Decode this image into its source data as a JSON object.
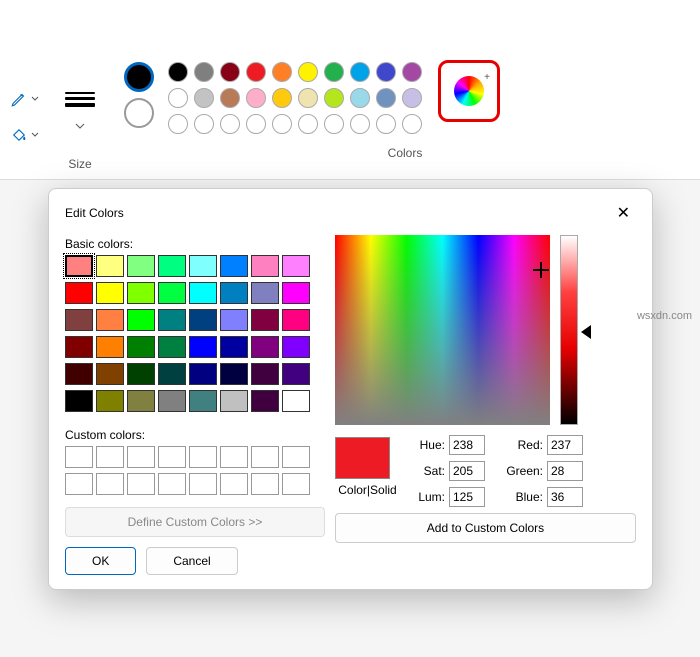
{
  "ribbon": {
    "size_label": "Size",
    "colors_label": "Colors",
    "palette": [
      "#000000",
      "#7f7f7f",
      "#880015",
      "#ed1c24",
      "#ff7f27",
      "#fff200",
      "#22b14c",
      "#00a2e8",
      "#3f48cc",
      "#a349a4",
      "#ffffff",
      "#c3c3c3",
      "#b97a57",
      "#ffaec9",
      "#ffc90e",
      "#efe4b0",
      "#b5e61d",
      "#99d9ea",
      "#7092be",
      "#c8bfe7"
    ],
    "primary_color": "#000000",
    "secondary_color": "#ffffff"
  },
  "dialog": {
    "title": "Edit Colors",
    "basic_label": "Basic colors:",
    "custom_label": "Custom colors:",
    "define_label": "Define Custom Colors >>",
    "ok_label": "OK",
    "cancel_label": "Cancel",
    "preview_label": "Color|Solid",
    "add_label": "Add to Custom Colors",
    "basic_colors": [
      "#ff8080",
      "#ffff80",
      "#80ff80",
      "#00ff80",
      "#80ffff",
      "#0080ff",
      "#ff80c0",
      "#ff80ff",
      "#ff0000",
      "#ffff00",
      "#80ff00",
      "#00ff40",
      "#00ffff",
      "#0080c0",
      "#8080c0",
      "#ff00ff",
      "#804040",
      "#ff8040",
      "#00ff00",
      "#008080",
      "#004080",
      "#8080ff",
      "#800040",
      "#ff0080",
      "#800000",
      "#ff8000",
      "#008000",
      "#008040",
      "#0000ff",
      "#0000a0",
      "#800080",
      "#8000ff",
      "#400000",
      "#804000",
      "#004000",
      "#004040",
      "#000080",
      "#000040",
      "#400040",
      "#400080",
      "#000000",
      "#808000",
      "#808040",
      "#808080",
      "#408080",
      "#c0c0c0",
      "#400040",
      "#ffffff"
    ],
    "selected_basic": 0,
    "fields": {
      "hue_label": "Hue:",
      "hue": "238",
      "sat_label": "Sat:",
      "sat": "205",
      "lum_label": "Lum:",
      "lum": "125",
      "red_label": "Red:",
      "red": "237",
      "green_label": "Green:",
      "green": "28",
      "blue_label": "Blue:",
      "blue": "36"
    },
    "preview_color": "#ed1c24"
  },
  "watermark": "wsxdn.com"
}
